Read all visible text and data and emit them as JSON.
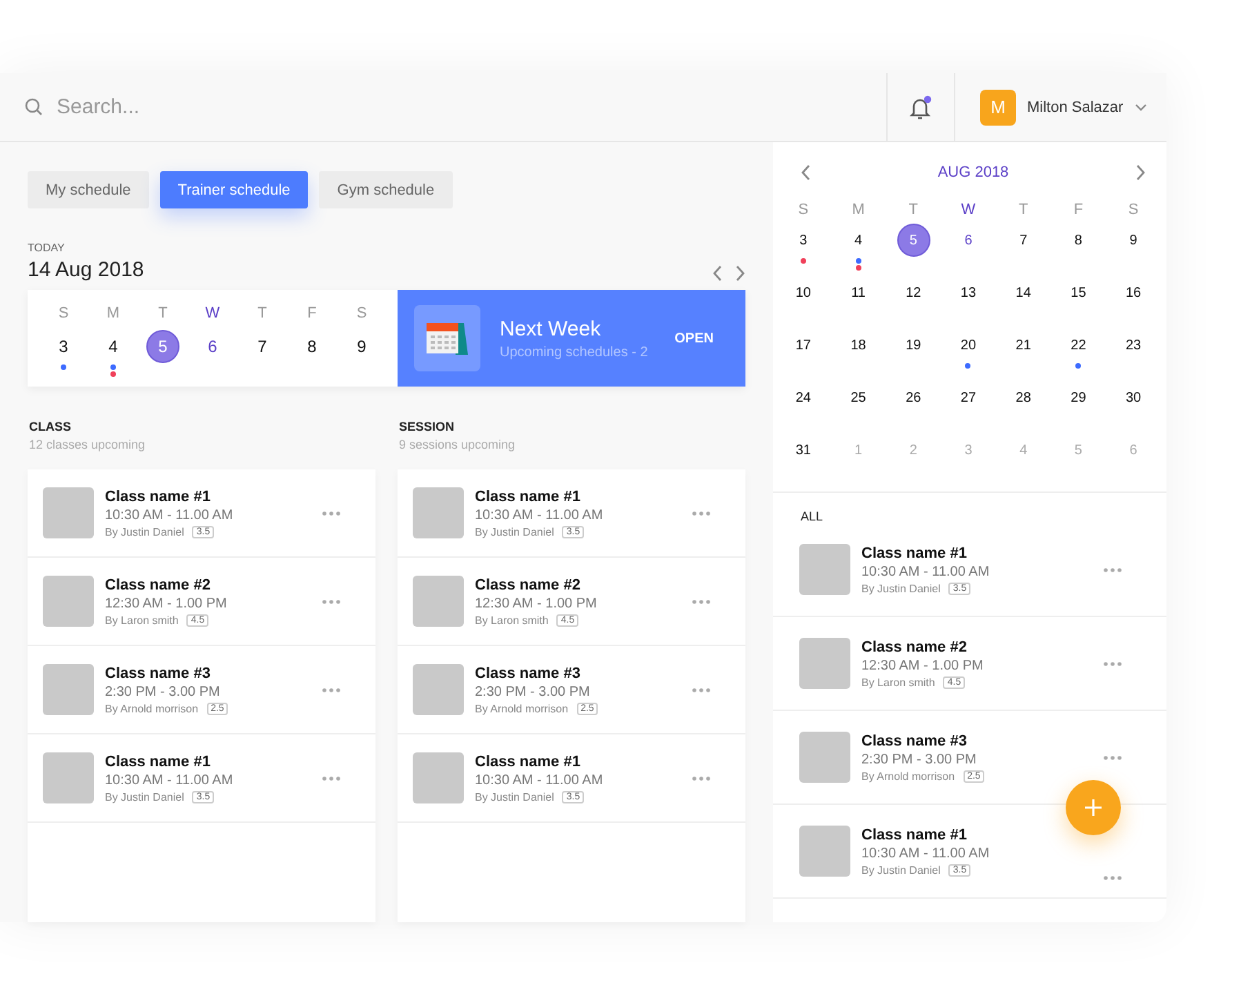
{
  "search": {
    "placeholder": "Search..."
  },
  "notifications": {
    "has_unread": true
  },
  "user": {
    "initial": "M",
    "name": "Milton Salazar"
  },
  "tabs": [
    {
      "label": "My schedule",
      "selected": false
    },
    {
      "label": "Trainer schedule",
      "selected": true
    },
    {
      "label": "Gym schedule",
      "selected": false
    }
  ],
  "today": {
    "label": "TODAY",
    "date": "14 Aug 2018"
  },
  "week": {
    "weekdays": [
      {
        "label": "S",
        "highlighted": false
      },
      {
        "label": "M",
        "highlighted": false
      },
      {
        "label": "T",
        "highlighted": false
      },
      {
        "label": "W",
        "highlighted": true
      },
      {
        "label": "T",
        "highlighted": false
      },
      {
        "label": "F",
        "highlighted": false
      },
      {
        "label": "S",
        "highlighted": false
      }
    ],
    "days": [
      {
        "day": "3",
        "selected": false,
        "current": false,
        "outside": false,
        "dots": [
          {
            "color": "#3d6bff"
          }
        ]
      },
      {
        "day": "4",
        "selected": false,
        "current": false,
        "outside": false,
        "dots": [
          {
            "color": "#3d6bff"
          },
          {
            "color": "#f0405a"
          }
        ]
      },
      {
        "day": "5",
        "selected": true,
        "current": false,
        "outside": false
      },
      {
        "day": "6",
        "selected": false,
        "current": true,
        "outside": false
      },
      {
        "day": "7",
        "selected": false,
        "current": false,
        "outside": false
      },
      {
        "day": "8",
        "selected": false,
        "current": false,
        "outside": false
      },
      {
        "day": "9",
        "selected": false,
        "current": false,
        "outside": false
      }
    ]
  },
  "next_week": {
    "title": "Next Week",
    "subtitle": "Upcoming schedules - 2",
    "action": "OPEN"
  },
  "sections": [
    {
      "title": "CLASS",
      "subtitle": "12 classes upcoming",
      "items": [
        {
          "name": "Class name #1",
          "time": "10:30 AM - 11.00 AM",
          "trainer": "By Justin Daniel",
          "rating": "3.5"
        },
        {
          "name": "Class name #2",
          "time": "12:30 AM - 1.00 PM",
          "trainer": "By Laron smith",
          "rating": "4.5"
        },
        {
          "name": "Class name #3",
          "time": "2:30 PM - 3.00 PM",
          "trainer": "By Arnold morrison",
          "rating": "2.5"
        },
        {
          "name": "Class name #1",
          "time": "10:30 AM - 11.00 AM",
          "trainer": "By Justin Daniel",
          "rating": "3.5"
        }
      ]
    },
    {
      "title": "SESSION",
      "subtitle": "9 sessions upcoming",
      "items": [
        {
          "name": "Class name #1",
          "time": "10:30 AM - 11.00 AM",
          "trainer": "By Justin Daniel",
          "rating": "3.5"
        },
        {
          "name": "Class name #2",
          "time": "12:30 AM - 1.00 PM",
          "trainer": "By Laron smith",
          "rating": "4.5"
        },
        {
          "name": "Class name #3",
          "time": "2:30 PM - 3.00 PM",
          "trainer": "By Arnold morrison",
          "rating": "2.5"
        },
        {
          "name": "Class name #1",
          "time": "10:30 AM - 11.00 AM",
          "trainer": "By Justin Daniel",
          "rating": "3.5"
        }
      ]
    }
  ],
  "month": {
    "title": "AUG 2018",
    "weekdays": [
      {
        "label": "S",
        "highlighted": false
      },
      {
        "label": "M",
        "highlighted": false
      },
      {
        "label": "T",
        "highlighted": false
      },
      {
        "label": "W",
        "highlighted": true
      },
      {
        "label": "T",
        "highlighted": false
      },
      {
        "label": "F",
        "highlighted": false
      },
      {
        "label": "S",
        "highlighted": false
      }
    ],
    "days": [
      {
        "day": "3",
        "selected": false,
        "current": false,
        "outside": false,
        "dots": [
          {
            "color": "#f0405a"
          }
        ]
      },
      {
        "day": "4",
        "selected": false,
        "current": false,
        "outside": false,
        "dots": [
          {
            "color": "#3d6bff"
          },
          {
            "color": "#f0405a"
          }
        ]
      },
      {
        "day": "5",
        "selected": true,
        "current": false,
        "outside": false
      },
      {
        "day": "6",
        "selected": false,
        "current": true,
        "outside": false
      },
      {
        "day": "7",
        "selected": false,
        "current": false,
        "outside": false
      },
      {
        "day": "8",
        "selected": false,
        "current": false,
        "outside": false
      },
      {
        "day": "9",
        "selected": false,
        "current": false,
        "outside": false
      },
      {
        "day": "10",
        "selected": false,
        "current": false,
        "outside": false
      },
      {
        "day": "11",
        "selected": false,
        "current": false,
        "outside": false
      },
      {
        "day": "12",
        "selected": false,
        "current": false,
        "outside": false
      },
      {
        "day": "13",
        "selected": false,
        "current": false,
        "outside": false
      },
      {
        "day": "14",
        "selected": false,
        "current": false,
        "outside": false
      },
      {
        "day": "15",
        "selected": false,
        "current": false,
        "outside": false
      },
      {
        "day": "16",
        "selected": false,
        "current": false,
        "outside": false
      },
      {
        "day": "17",
        "selected": false,
        "current": false,
        "outside": false
      },
      {
        "day": "18",
        "selected": false,
        "current": false,
        "outside": false
      },
      {
        "day": "19",
        "selected": false,
        "current": false,
        "outside": false
      },
      {
        "day": "20",
        "selected": false,
        "current": false,
        "outside": false,
        "dots": [
          {
            "color": "#3d6bff"
          }
        ]
      },
      {
        "day": "21",
        "selected": false,
        "current": false,
        "outside": false
      },
      {
        "day": "22",
        "selected": false,
        "current": false,
        "outside": false,
        "dots": [
          {
            "color": "#3d6bff"
          }
        ]
      },
      {
        "day": "23",
        "selected": false,
        "current": false,
        "outside": false
      },
      {
        "day": "24",
        "selected": false,
        "current": false,
        "outside": false
      },
      {
        "day": "25",
        "selected": false,
        "current": false,
        "outside": false
      },
      {
        "day": "26",
        "selected": false,
        "current": false,
        "outside": false
      },
      {
        "day": "27",
        "selected": false,
        "current": false,
        "outside": false
      },
      {
        "day": "28",
        "selected": false,
        "current": false,
        "outside": false
      },
      {
        "day": "29",
        "selected": false,
        "current": false,
        "outside": false
      },
      {
        "day": "30",
        "selected": false,
        "current": false,
        "outside": false
      },
      {
        "day": "31",
        "selected": false,
        "current": false,
        "outside": false
      },
      {
        "day": "1",
        "selected": false,
        "current": false,
        "outside": true
      },
      {
        "day": "2",
        "selected": false,
        "current": false,
        "outside": true
      },
      {
        "day": "3",
        "selected": false,
        "current": false,
        "outside": true
      },
      {
        "day": "4",
        "selected": false,
        "current": false,
        "outside": true
      },
      {
        "day": "5",
        "selected": false,
        "current": false,
        "outside": true
      },
      {
        "day": "6",
        "selected": false,
        "current": false,
        "outside": true
      }
    ]
  },
  "all": {
    "title": "ALL",
    "items": [
      {
        "name": "Class name #1",
        "time": "10:30 AM - 11.00 AM",
        "trainer": "By Justin Daniel",
        "rating": "3.5"
      },
      {
        "name": "Class name #2",
        "time": "12:30 AM - 1.00 PM",
        "trainer": "By Laron smith",
        "rating": "4.5"
      },
      {
        "name": "Class name #3",
        "time": "2:30 PM - 3.00 PM",
        "trainer": "By Arnold morrison",
        "rating": "2.5"
      },
      {
        "name": "Class name #1",
        "time": "10:30 AM - 11.00 AM",
        "trainer": "By Justin Daniel",
        "rating": "3.5"
      }
    ]
  }
}
